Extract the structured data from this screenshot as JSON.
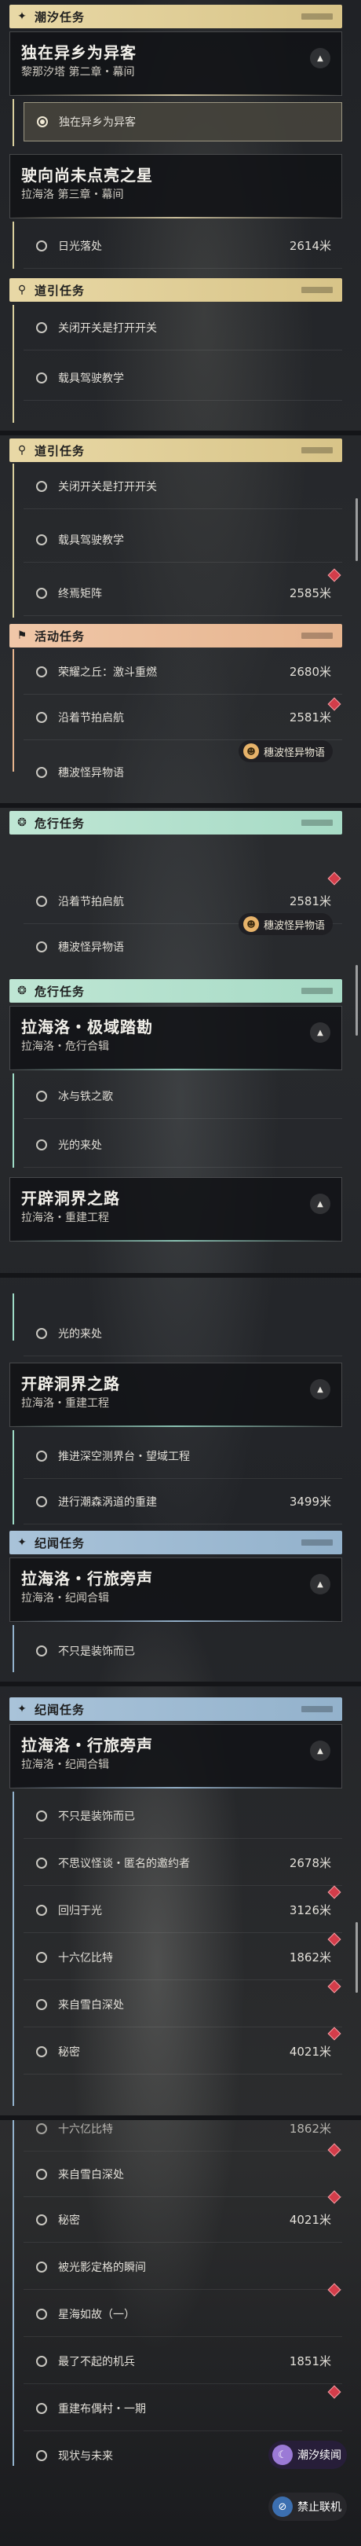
{
  "shot1": {
    "cat_chaoxi": "潮汐任务",
    "sec1": {
      "title": "独在异乡为异客",
      "sub": "黎那汐塔 第二章・幕间"
    },
    "sel_task": "独在异乡为异客",
    "sec2": {
      "title": "驶向尚未点亮之星",
      "sub": "拉海洛 第三章・幕间"
    },
    "task_sun": "日光落处",
    "task_sun_dist": "2614米",
    "cat_guide": "道引任务",
    "guide_tasks": [
      "关闭开关是打开开关",
      "载具驾驶教学"
    ]
  },
  "shot2": {
    "cat_guide": "道引任务",
    "guide_tasks": [
      "关闭开关是打开开关",
      "载具驾驶教学",
      "终焉矩阵"
    ],
    "guide_dist": "2585米",
    "cat_activity": "活动任务",
    "activity_tasks": [
      "荣耀之丘：激斗重燃",
      "沿着节拍启航",
      "穗波怪异物语"
    ],
    "activity_dists": [
      "2680米",
      "2581米"
    ],
    "badge": "穗波怪异物语",
    "cat_danger": "危行任务"
  },
  "shot3": {
    "tasks": [
      "沿着节拍启航",
      "穗波怪异物语"
    ],
    "dist": "2581米",
    "badge": "穗波怪异物语",
    "cat_danger": "危行任务",
    "sec1": {
      "title": "拉海洛・极域踏勘",
      "sub": "拉海洛・危行合辑"
    },
    "sec1_tasks": [
      "冰与铁之歌",
      "光的来处"
    ],
    "sec2": {
      "title": "开辟洞界之路",
      "sub": "拉海洛・重建工程"
    }
  },
  "shot4": {
    "task_light": "光的来处",
    "sec1": {
      "title": "开辟洞界之路",
      "sub": "拉海洛・重建工程"
    },
    "tasks": [
      "推进深空测界台・望域工程",
      "进行潮森涡道的重建"
    ],
    "dist": "3499米",
    "cat_record": "纪闻任务",
    "sec2": {
      "title": "拉海洛・行旅旁声",
      "sub": "拉海洛・纪闻合辑"
    },
    "task_deco": "不只是装饰而已"
  },
  "shot5": {
    "cat_record": "纪闻任务",
    "sec": {
      "title": "拉海洛・行旅旁声",
      "sub": "拉海洛・纪闻合辑"
    },
    "tasks": [
      "不只是装饰而已",
      "不思议怪谈・匿名的邀约者",
      "回归于光",
      "十六亿比特",
      "来自雪白深处",
      "秘密"
    ],
    "dists": [
      "2678米",
      "3126米",
      "1862米",
      "4021米"
    ]
  },
  "shot6": {
    "partial_task": "十六亿比特",
    "partial_dist": "1862米",
    "tasks": [
      "来自雪白深处",
      "秘密",
      "被光影定格的瞬间",
      "星海如故（一）",
      "最了不起的机兵",
      "重建布偶村・一期",
      "现状与未来"
    ],
    "dists": [
      "4021米",
      "1851米"
    ],
    "btn_chaoxi": "潮汐续闻",
    "btn_offline": "禁止联机"
  }
}
